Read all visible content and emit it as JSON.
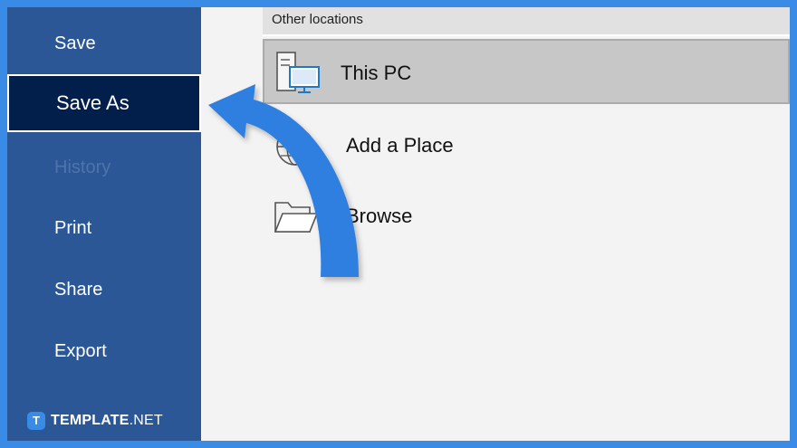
{
  "sidebar": {
    "items": [
      {
        "label": "Save",
        "state": "normal"
      },
      {
        "label": "Save As",
        "state": "selected"
      },
      {
        "label": "History",
        "state": "disabled"
      },
      {
        "label": "Print",
        "state": "normal"
      },
      {
        "label": "Share",
        "state": "normal"
      },
      {
        "label": "Export",
        "state": "normal"
      }
    ]
  },
  "locations": {
    "header": "Other locations",
    "items": [
      {
        "label": "This PC",
        "icon": "this-pc-icon"
      },
      {
        "label": "Add a Place",
        "icon": "globe-icon"
      },
      {
        "label": "Browse",
        "icon": "folder-icon"
      }
    ]
  },
  "brand": {
    "badge": "T",
    "name_bold": "TEMPLATE",
    "name_suffix": ".NET"
  },
  "colors": {
    "frame": "#3a8be6",
    "sidebar": "#2b5797",
    "sidebar_selected": "#021f4c",
    "content_bg": "#f3f3f3",
    "arrow": "#2f7fe0"
  }
}
